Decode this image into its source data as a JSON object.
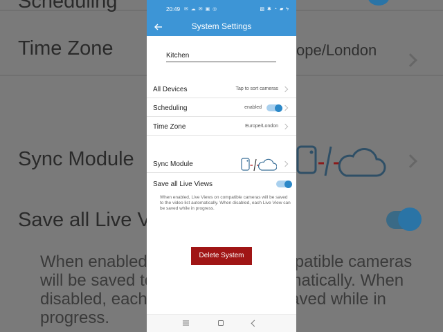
{
  "background": {
    "rows": [
      {
        "label": "Scheduling"
      },
      {
        "label": "Time Zone",
        "value": "ope/London"
      },
      {
        "label": "Sync Module"
      },
      {
        "label": "Save all Live V"
      }
    ],
    "note": "When enabled, Live Views on compatible cameras will be saved to the video list automatically. When disabled, each Live View can be saved while in progress."
  },
  "status_bar": {
    "time": "20:49",
    "left_icons": "✉ ☁ ✉ ▣ ◎",
    "right_icons": "▧ ✱ ◔ ▰ ϟ"
  },
  "app_bar": {
    "title": "System Settings",
    "back_icon": "arrow-left-icon"
  },
  "system": {
    "name": "Kitchen"
  },
  "settings": {
    "all_devices": {
      "label": "All Devices",
      "value": "Tap to sort cameras"
    },
    "scheduling": {
      "label": "Scheduling",
      "value": "enabled",
      "toggle_on": true
    },
    "time_zone": {
      "label": "Time Zone",
      "value": "Europe/London"
    },
    "sync_module": {
      "label": "Sync Module"
    },
    "save_live_views": {
      "label": "Save all Live Views",
      "toggle_on": true,
      "note": "When enabled, Live Views on compatible cameras will be saved to the video list automatically. When disabled, each Live View can be saved while in progress."
    }
  },
  "actions": {
    "delete_label": "Delete System"
  },
  "colors": {
    "primary": "#3d95d6",
    "danger": "#a01515",
    "toggle_on": "#2c88c8",
    "sync_module_red": "#b22222"
  }
}
